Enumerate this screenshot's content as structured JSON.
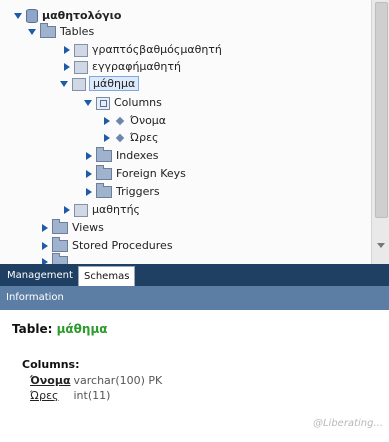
{
  "tree": {
    "schema": "μαθητολόγιο",
    "tables_folder": "Tables",
    "tables": [
      "γραπτόςβαθμόςμαθητή",
      "εγγραφήμαθητή",
      "μάθημα",
      "μαθητής"
    ],
    "columns_folder": "Columns",
    "columns": [
      "Όνομα",
      "Ώρες"
    ],
    "subfolders": [
      "Indexes",
      "Foreign Keys",
      "Triggers"
    ],
    "other_folders": [
      "Views",
      "Stored Procedures"
    ]
  },
  "tabs": {
    "management": "Management",
    "schemas": "Schemas"
  },
  "info_bar": "Information",
  "table_info": {
    "table_prefix": "Table:",
    "table_name": "μάθημα",
    "columns_heading": "Columns:",
    "columns": [
      {
        "name": "Όνομα",
        "type": "varchar(100) PK"
      },
      {
        "name": "Ώρες",
        "type": "int(11)"
      }
    ]
  },
  "watermark": "@Liberating..."
}
